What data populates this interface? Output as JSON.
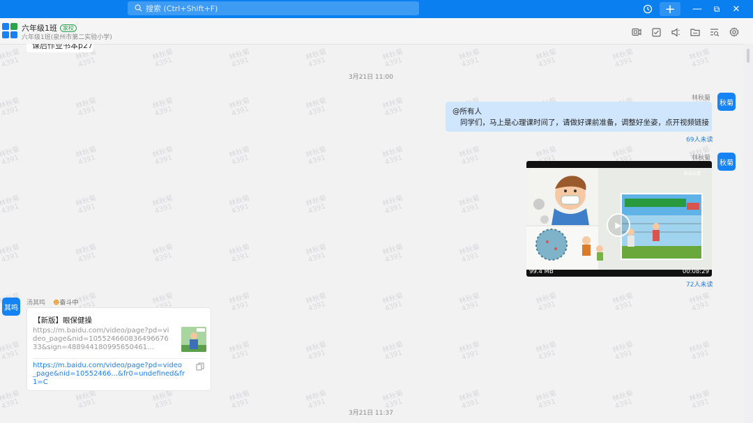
{
  "search": {
    "placeholder": "搜索 (Ctrl+Shift+F)"
  },
  "topbar": {
    "history_icon": "history-icon",
    "plus": "+",
    "minimize": "—",
    "restore": "⧉",
    "close": "✕"
  },
  "header": {
    "title": "六年级1班",
    "badge": "家校",
    "subtitle": "六年级1班(泉州市第二实验小学)",
    "icons": [
      "video-call-icon",
      "task-check-icon",
      "announcement-icon",
      "folder-icon",
      "search-record-icon",
      "settings-icon"
    ]
  },
  "watermark": {
    "name": "林秋菊",
    "number": "4391"
  },
  "chat": {
    "prev_message": "课后作业书本p27",
    "timestamp_1": "3月21日 11:00",
    "msg1": {
      "sender": "林秋菊",
      "avatar": "秋菊",
      "mention": "@所有人",
      "text": "同学们，马上是心理课时间了，请做好课前准备，调整好坐姿，点开视频链接",
      "unread": "69人未读"
    },
    "msg2": {
      "sender": "林秋菊",
      "avatar": "秋菊",
      "video_size": "99.4 MB",
      "video_duration": "00:08:29",
      "video_tag": "来自云盘",
      "unread": "72人未读"
    },
    "msg3": {
      "sender": "汤其鸣",
      "avatar": "其鸣",
      "status": "奋斗中",
      "card_title": "【新版】眼保健操",
      "card_url_preview": "https://m.baidu.com/video/page?pd=video_page&nid=10552466083649667633&sign=4889441809956504​61...",
      "card_link": "https://m.baidu.com/video/page?pd=video_page&nid=10552466...&fr0=undefined&fr1=C"
    },
    "timestamp_2": "3月21日 11:37"
  },
  "colors": {
    "accent": "#0a7ff0",
    "bubble": "#cfe6fd",
    "link": "#1a7ff0"
  }
}
